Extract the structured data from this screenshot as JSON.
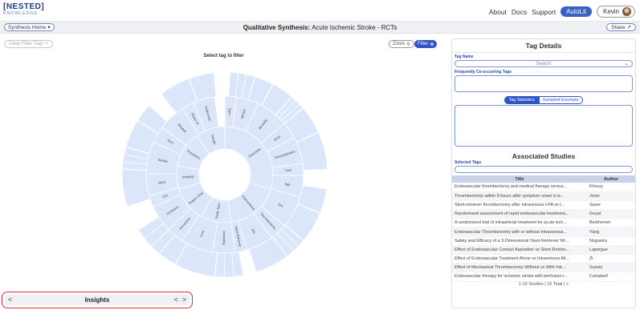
{
  "header": {
    "logo_line1": "[NESTED]",
    "logo_line2": "KNOWLEDGE",
    "nav": [
      "About",
      "Docs",
      "Support"
    ],
    "autolit_label": "AutoLit",
    "user_label": "Kevin"
  },
  "subbar": {
    "synthesis_home": "Synthesis Home",
    "title_bold": "Qualitative Synthesis:",
    "title_rest": " Acute Ischemic Stroke - RCTs",
    "share": "Share"
  },
  "left": {
    "clear_filter": "Clear Filter Tags",
    "zoom_label": "Zoom",
    "filter_label": "Filter",
    "select_prompt": "Select tag to filter"
  },
  "sunburst": {
    "inner_labels": [
      "Outcomes",
      "Interventions",
      "Study Type",
      "Patient Char.",
      "Imaging",
      "Population",
      "Design"
    ],
    "outer_labels": [
      "mRS",
      "NIHSS",
      "Mortality",
      "sICH",
      "Recanalization",
      "Time",
      "Age",
      "Sex",
      "Thrombectomy",
      "tPA",
      "Stent Retriever",
      "Aspiration",
      "Core",
      "Penumbra",
      "Occlusion",
      "ICA",
      "MCA",
      "Basilar",
      "RCT",
      "Blinded",
      "Phase III",
      "Multicenter"
    ]
  },
  "insights": {
    "title": "Insights",
    "left_arrow": "<",
    "prev": "<",
    "next": ">"
  },
  "right": {
    "tag_details_title": "Tag Details",
    "tag_name_label": "Tag Name",
    "tag_name_placeholder": "Search",
    "cooccur_label": "Frequently Co-occurring Tags",
    "tab_statistics": "Tag Statistics",
    "tab_excerpts": "Sampled Excerpts",
    "assoc_title": "Associated Studies",
    "selected_tags_label": "Selected Tags",
    "table_headers": [
      "Title",
      "Author"
    ],
    "studies": [
      {
        "title": "Endovascular thrombectomy and medical therapy versus...",
        "author": "Khoury"
      },
      {
        "title": "Thrombectomy within 8 hours after symptom onset in is...",
        "author": "Jovin"
      },
      {
        "title": "Stent-retriever thrombectomy after intravenous t-PA vs t...",
        "author": "Saver"
      },
      {
        "title": "Randomized assessment of rapid endovascular treatment...",
        "author": "Goyal"
      },
      {
        "title": "A randomized trial of intraarterial treatment for acute isch...",
        "author": "Berkhemer"
      },
      {
        "title": "Endovascular Thrombectomy with or without Intravenous...",
        "author": "Yang"
      },
      {
        "title": "Safety and Efficacy of a 3-Dimensional Stent Retriever Wi...",
        "author": "Nogueira"
      },
      {
        "title": "Effect of Endovascular Contact Aspiration vs Stent Retriev...",
        "author": "Lapergue"
      },
      {
        "title": "Effect of Endovascular Treatment Alone vs Intravenous Alt...",
        "author": "Zi"
      },
      {
        "title": "Effect of Mechanical Thrombectomy Without vs With Intr...",
        "author": "Suzuki"
      },
      {
        "title": "Endovascular therapy for ischemic stroke with perfusion-i...",
        "author": "Campbell"
      }
    ],
    "footer": "1-15 Studies | 15 Total | >"
  },
  "colors": {
    "brand": "#1b3d8f",
    "accent": "#2f55c4",
    "sunburst_fill": "#dbe6fb",
    "sunburst_stroke": "#ffffff",
    "highlight_border": "#d9313a"
  }
}
